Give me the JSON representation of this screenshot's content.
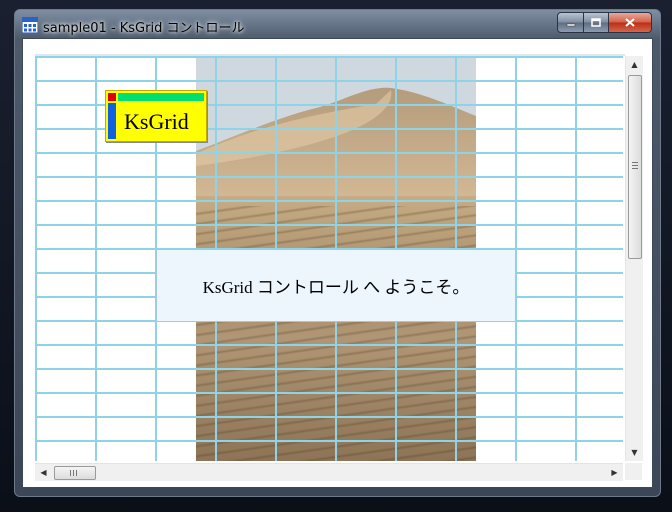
{
  "window": {
    "title": "sample01 - KsGrid コントロール",
    "icon": "grid-app-icon",
    "buttons": {
      "minimize": "minimize-icon",
      "maximize": "maximize-icon",
      "close": "close-icon"
    }
  },
  "logo": {
    "text": "KsGrid"
  },
  "welcome": {
    "text": "KsGrid コントロール へ ようこそ。"
  },
  "grid": {
    "line_color": "#8fd3e8"
  },
  "scrollbars": {
    "vertical": {
      "up": "▲",
      "down": "▼"
    },
    "horizontal": {
      "left": "◀",
      "right": "▶"
    }
  }
}
